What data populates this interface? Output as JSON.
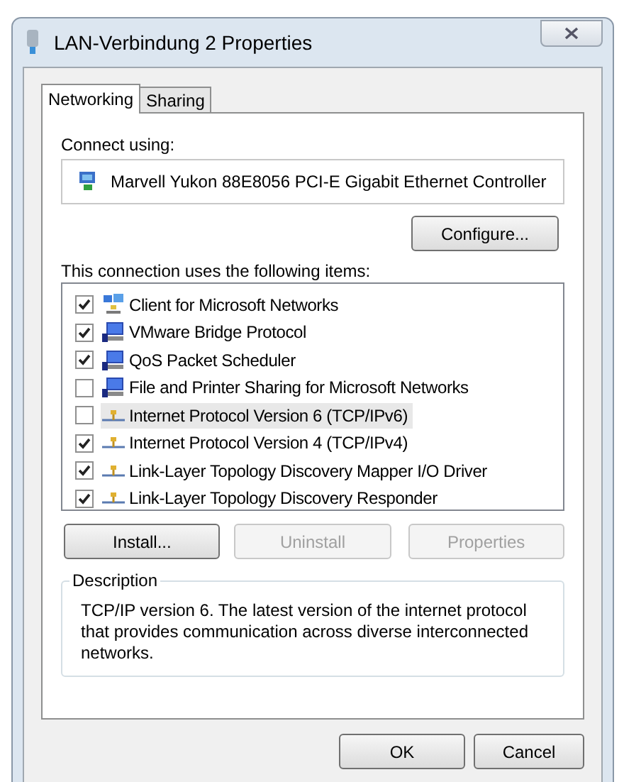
{
  "window": {
    "title": "LAN-Verbindung 2 Properties"
  },
  "tabs": [
    {
      "label": "Networking",
      "selected": true
    },
    {
      "label": "Sharing",
      "selected": false
    }
  ],
  "connect_using": {
    "label": "Connect using:",
    "adapter": "Marvell Yukon 88E8056 PCI-E Gigabit Ethernet Controller"
  },
  "configure_button": "Configure...",
  "items_label": "This connection uses the following items:",
  "items": [
    {
      "label": "Client for Microsoft Networks",
      "kind": "client",
      "checked": true,
      "selected": false
    },
    {
      "label": "VMware Bridge Protocol",
      "kind": "service",
      "checked": true,
      "selected": false
    },
    {
      "label": "QoS Packet Scheduler",
      "kind": "service",
      "checked": true,
      "selected": false
    },
    {
      "label": "File and Printer Sharing for Microsoft Networks",
      "kind": "service",
      "checked": false,
      "selected": false
    },
    {
      "label": "Internet Protocol Version 6 (TCP/IPv6)",
      "kind": "protocol",
      "checked": false,
      "selected": true
    },
    {
      "label": "Internet Protocol Version 4 (TCP/IPv4)",
      "kind": "protocol",
      "checked": true,
      "selected": false
    },
    {
      "label": "Link-Layer Topology Discovery Mapper I/O Driver",
      "kind": "protocol",
      "checked": true,
      "selected": false
    },
    {
      "label": "Link-Layer Topology Discovery Responder",
      "kind": "protocol",
      "checked": true,
      "selected": false
    }
  ],
  "item_buttons": [
    {
      "label": "Install...",
      "disabled": false
    },
    {
      "label": "Uninstall",
      "disabled": true
    },
    {
      "label": "Properties",
      "disabled": true
    }
  ],
  "description": {
    "title": "Description",
    "text": "TCP/IP version 6. The latest version of the internet protocol that provides communication across diverse interconnected networks."
  },
  "dialog_buttons": [
    "OK",
    "Cancel"
  ]
}
